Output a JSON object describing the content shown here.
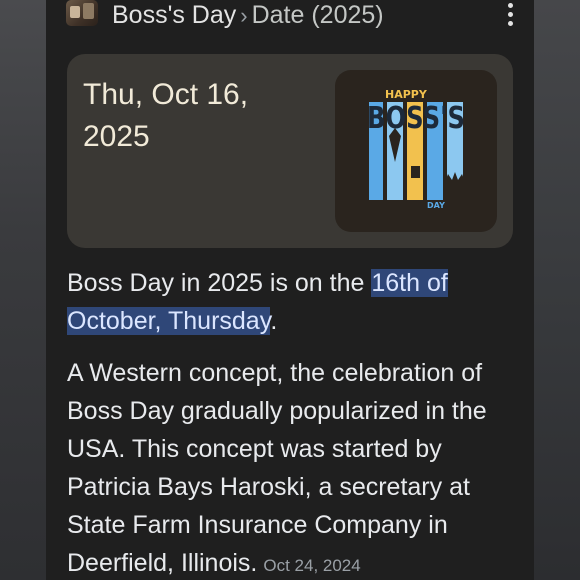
{
  "breadcrumb": {
    "site": "Boss's Day",
    "separator": "›",
    "page": "Date (2025)"
  },
  "card": {
    "date_line1": "Thu, Oct 16,",
    "date_line2": "2025",
    "logo": {
      "top": "HAPPY",
      "main": "BOSS'S",
      "bottom": "DAY"
    }
  },
  "answer": {
    "before": "Boss Day in 2025 is on the ",
    "highlight": "16th of October, Thursday",
    "after": "."
  },
  "description": {
    "text": "A Western concept, the celebration of Boss Day gradually popularized in the USA. This concept was started by Patricia Bays Haroski, a secretary at State Farm Insurance Company in Deerfield, Illinois.",
    "date": "Oct 24, 2024"
  },
  "colors": {
    "highlight_bg": "#2f4778",
    "card_bg": "#3a3834",
    "logo_blue": "#5aa9e6",
    "logo_gold": "#f2c14e"
  }
}
